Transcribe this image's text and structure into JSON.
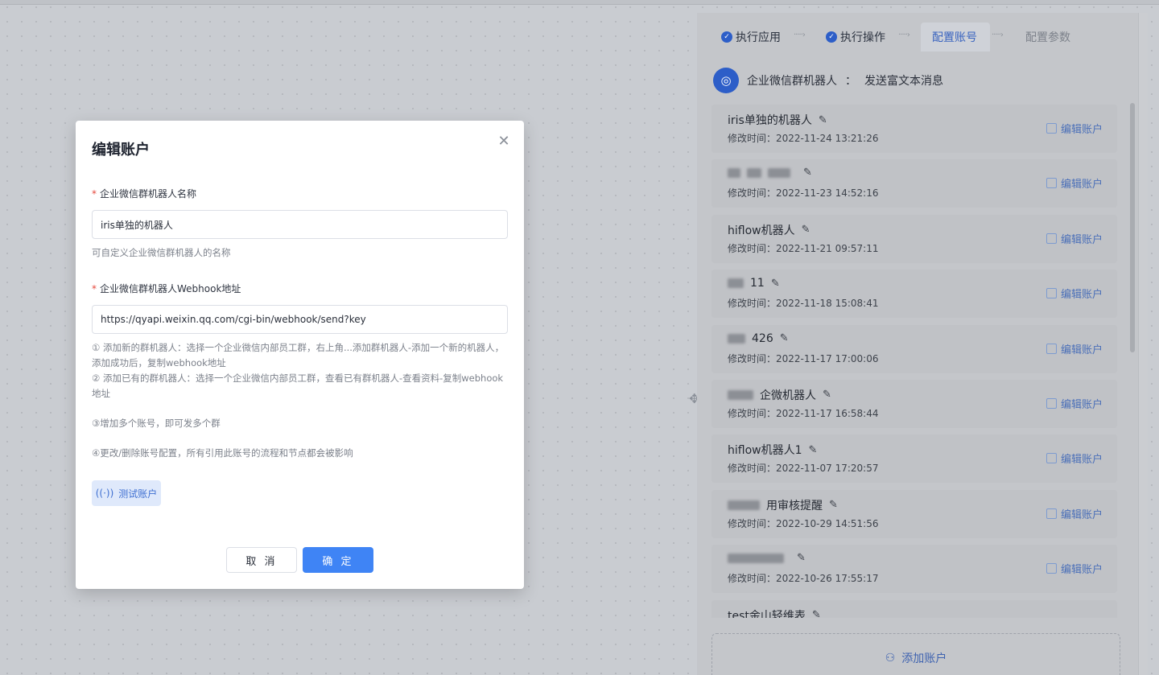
{
  "steps": [
    {
      "label": "执行应用",
      "state": "done"
    },
    {
      "label": "执行操作",
      "state": "done"
    },
    {
      "label": "配置账号",
      "state": "active"
    },
    {
      "label": "配置参数",
      "state": "todo"
    }
  ],
  "app": {
    "name": "企业微信群机器人",
    "separator": "：",
    "action": "发送富文本消息"
  },
  "accounts": [
    {
      "name": "iris单独的机器人",
      "time_label": "修改时间：",
      "time": "2022-11-24 13:21:26",
      "edit_label": "编辑账户"
    },
    {
      "name": "",
      "time_label": "修改时间：",
      "time": "2022-11-23 14:52:16",
      "edit_label": "编辑账户"
    },
    {
      "name": "hiflow机器人",
      "time_label": "修改时间：",
      "time": "2022-11-21 09:57:11",
      "edit_label": "编辑账户"
    },
    {
      "name": "11",
      "time_label": "修改时间：",
      "time": "2022-11-18 15:08:41",
      "edit_label": "编辑账户"
    },
    {
      "name": "426",
      "time_label": "修改时间：",
      "time": "2022-11-17 17:00:06",
      "edit_label": "编辑账户"
    },
    {
      "name": "企微机器人",
      "time_label": "修改时间：",
      "time": "2022-11-17 16:58:44",
      "edit_label": "编辑账户"
    },
    {
      "name": "hiflow机器人1",
      "time_label": "修改时间：",
      "time": "2022-11-07 17:20:57",
      "edit_label": "编辑账户"
    },
    {
      "name": "用审核提醒",
      "time_label": "修改时间：",
      "time": "2022-10-29 14:51:56",
      "edit_label": "编辑账户"
    },
    {
      "name": "",
      "time_label": "修改时间：",
      "time": "2022-10-26 17:55:17",
      "edit_label": "编辑账户"
    },
    {
      "name": "test金山轻维表",
      "time_label": "",
      "time": "",
      "edit_label": ""
    }
  ],
  "add_account_label": "添加账户",
  "modal": {
    "title": "编辑账户",
    "name_label": "企业微信群机器人名称",
    "name_value": "iris单独的机器人",
    "name_help": "可自定义企业微信群机器人的名称",
    "webhook_label": "企业微信群机器人Webhook地址",
    "webhook_value": "https://qyapi.weixin.qq.com/cgi-bin/webhook/send?key",
    "help_1": "① 添加新的群机器人：选择一个企业微信内部员工群，右上角...添加群机器人-添加一个新的机器人，添加成功后，复制webhook地址",
    "help_2": "② 添加已有的群机器人：选择一个企业微信内部员工群，查看已有群机器人-查看资料-复制webhook地址",
    "help_3": "③增加多个账号，即可发多个群",
    "help_4": "④更改/删除账号配置，所有引用此账号的流程和节点都会被影响",
    "test_label": "测试账户",
    "cancel_label": "取 消",
    "ok_label": "确 定"
  },
  "colors": {
    "primary": "#3f84f5",
    "required": "#e5483c",
    "step_done": "#2d5ec8"
  }
}
